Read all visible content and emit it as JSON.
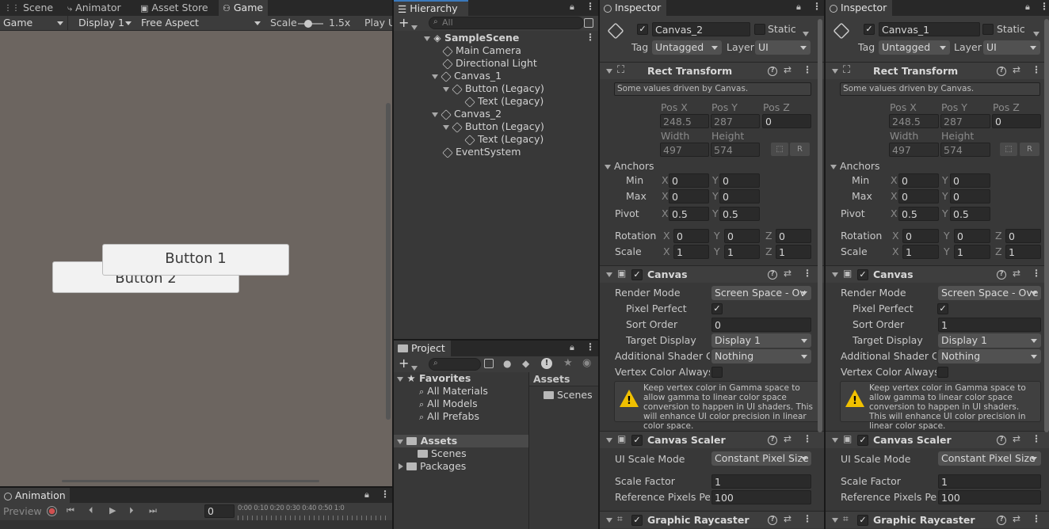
{
  "game": {
    "tabs": {
      "scene": "Scene",
      "animator": "Animator",
      "asset_store": "Asset Store",
      "game": "Game"
    },
    "toolbar": {
      "mode": "Game",
      "display": "Display 1",
      "aspect": "Free Aspect",
      "scale_label": "Scale",
      "scale_value": "1.5x",
      "play": "Play U"
    },
    "buttons": {
      "b1": "Button 1",
      "b2": "Button 2"
    }
  },
  "animation": {
    "tab": "Animation",
    "preview": "Preview",
    "frame": "0",
    "ruler": "0:00 0:10 0:20 0:30 0:40 0:50 1:0"
  },
  "hierarchy": {
    "tab": "Hierarchy",
    "search_placeholder": "All",
    "items": [
      "SampleScene",
      "Main Camera",
      "Directional Light",
      "Canvas_1",
      "Button (Legacy)",
      "Text (Legacy)",
      "Canvas_2",
      "Button (Legacy)",
      "Text (Legacy)",
      "EventSystem"
    ]
  },
  "project": {
    "tab": "Project",
    "favorites": "Favorites",
    "fav_items": [
      "All Materials",
      "All Models",
      "All Prefabs"
    ],
    "tree": {
      "assets": "Assets",
      "scenes": "Scenes",
      "packages": "Packages"
    },
    "crumb": "Assets",
    "content": [
      "Scenes"
    ]
  },
  "inspectors": [
    {
      "tab": "Inspector",
      "name": "Canvas_2",
      "static": "Static",
      "tag_label": "Tag",
      "tag": "Untagged",
      "layer_label": "Layer",
      "layer": "UI",
      "rect": {
        "title": "Rect Transform",
        "note": "Some values driven by Canvas.",
        "posx_l": "Pos X",
        "posy_l": "Pos Y",
        "posz_l": "Pos Z",
        "posx": "248.5",
        "posy": "287",
        "posz": "0",
        "w_l": "Width",
        "h_l": "Height",
        "w": "497",
        "h": "574",
        "r": "R",
        "anchors": "Anchors",
        "min": "Min",
        "max": "Max",
        "pivot": "Pivot",
        "rotation": "Rotation",
        "scale": "Scale",
        "x": "X",
        "y": "Y",
        "z": "Z",
        "min_x": "0",
        "min_y": "0",
        "max_x": "0",
        "max_y": "0",
        "piv_x": "0.5",
        "piv_y": "0.5",
        "rot_x": "0",
        "rot_y": "0",
        "rot_z": "0",
        "sc_x": "1",
        "sc_y": "1",
        "sc_z": "1"
      },
      "canvas": {
        "title": "Canvas",
        "render_mode_l": "Render Mode",
        "render_mode": "Screen Space - Ov",
        "pixel_perfect": "Pixel Perfect",
        "sort_order_l": "Sort Order",
        "sort_order": "0",
        "target_display_l": "Target Display",
        "target_display": "Display 1",
        "shader_l": "Additional Shader Ch",
        "shader": "Nothing",
        "vertex_l": "Vertex Color Always I",
        "warning": "Keep vertex color in Gamma space to allow gamma to linear color space conversion to happen in UI shaders. This will enhance UI color precision in linear color space."
      },
      "scaler": {
        "title": "Canvas Scaler",
        "mode_l": "UI Scale Mode",
        "mode": "Constant Pixel Size",
        "factor_l": "Scale Factor",
        "factor": "1",
        "ref_l": "Reference Pixels Per",
        "ref": "100"
      },
      "raycaster": {
        "title": "Graphic Raycaster"
      }
    },
    {
      "tab": "Inspector",
      "name": "Canvas_1",
      "static": "Static",
      "tag_label": "Tag",
      "tag": "Untagged",
      "layer_label": "Layer",
      "layer": "UI",
      "rect": {
        "title": "Rect Transform",
        "note": "Some values driven by Canvas.",
        "posx_l": "Pos X",
        "posy_l": "Pos Y",
        "posz_l": "Pos Z",
        "posx": "248.5",
        "posy": "287",
        "posz": "0",
        "w_l": "Width",
        "h_l": "Height",
        "w": "497",
        "h": "574",
        "r": "R",
        "anchors": "Anchors",
        "min": "Min",
        "max": "Max",
        "pivot": "Pivot",
        "rotation": "Rotation",
        "scale": "Scale",
        "x": "X",
        "y": "Y",
        "z": "Z",
        "min_x": "0",
        "min_y": "0",
        "max_x": "0",
        "max_y": "0",
        "piv_x": "0.5",
        "piv_y": "0.5",
        "rot_x": "0",
        "rot_y": "0",
        "rot_z": "0",
        "sc_x": "1",
        "sc_y": "1",
        "sc_z": "1"
      },
      "canvas": {
        "title": "Canvas",
        "render_mode_l": "Render Mode",
        "render_mode": "Screen Space - Ove",
        "pixel_perfect": "Pixel Perfect",
        "sort_order_l": "Sort Order",
        "sort_order": "1",
        "target_display_l": "Target Display",
        "target_display": "Display 1",
        "shader_l": "Additional Shader Ch",
        "shader": "Nothing",
        "vertex_l": "Vertex Color Always I",
        "warning": "Keep vertex color in Gamma space to allow gamma to linear color space conversion to happen in UI shaders. This will enhance UI color precision in linear color space."
      },
      "scaler": {
        "title": "Canvas Scaler",
        "mode_l": "UI Scale Mode",
        "mode": "Constant Pixel Size",
        "factor_l": "Scale Factor",
        "factor": "1",
        "ref_l": "Reference Pixels Per",
        "ref": "100"
      },
      "raycaster": {
        "title": "Graphic Raycaster"
      }
    }
  ]
}
